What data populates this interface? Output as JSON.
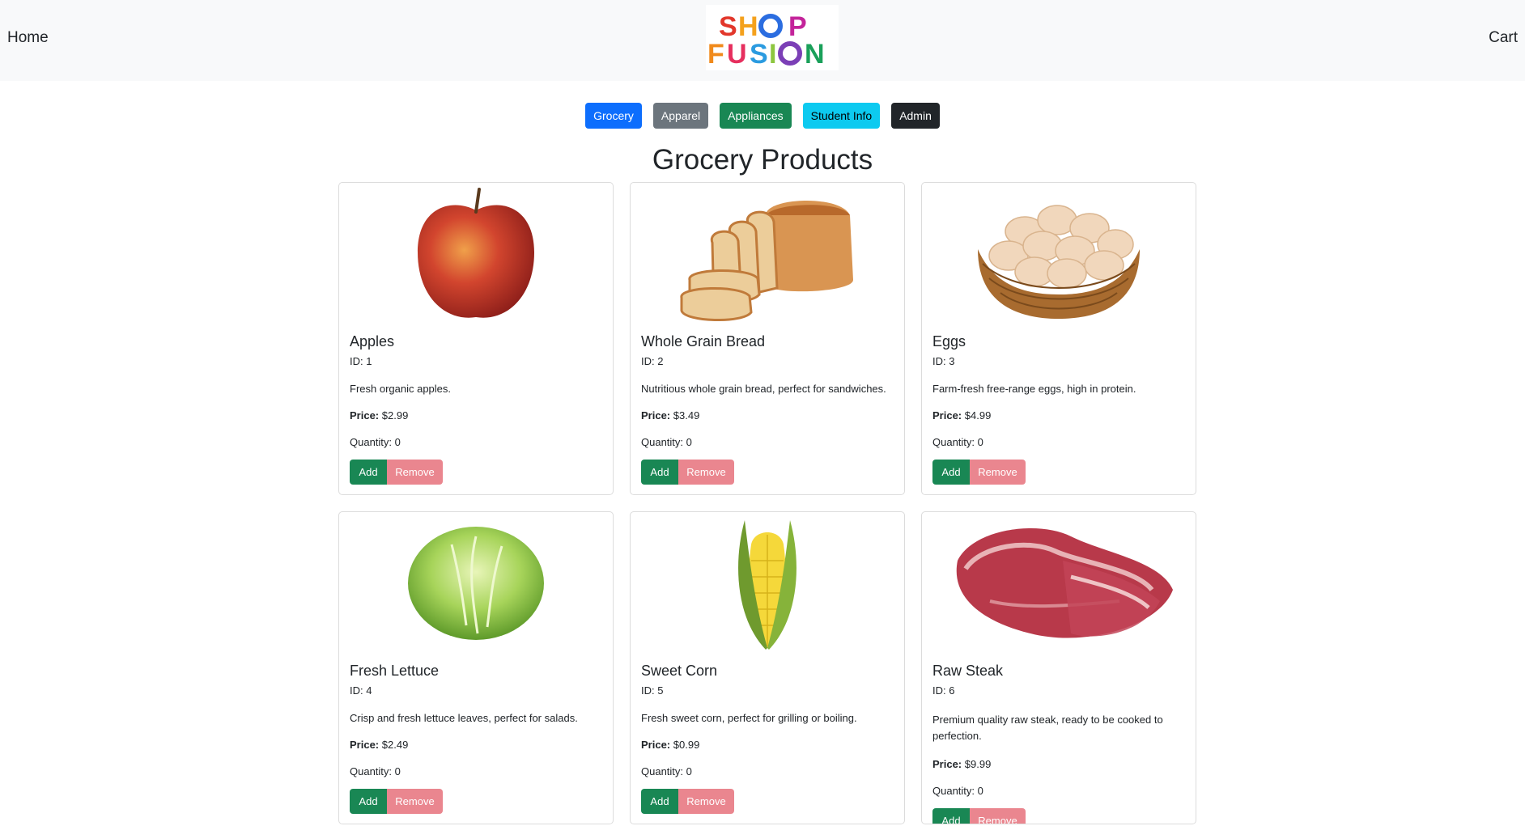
{
  "navbar": {
    "home_label": "Home",
    "cart_label": "Cart",
    "logo_text_line1": "SHOP",
    "logo_text_line2": "FUSION"
  },
  "categories": [
    {
      "label": "Grocery",
      "color": "#0d6efd"
    },
    {
      "label": "Apparel",
      "color": "#6c757d"
    },
    {
      "label": "Appliances",
      "color": "#198754"
    },
    {
      "label": "Student Info",
      "color": "#0dcaf0"
    },
    {
      "label": "Admin",
      "color": "#212529"
    }
  ],
  "page_title": "Grocery Products",
  "buttons": {
    "add_label": "Add",
    "remove_label": "Remove"
  },
  "labels": {
    "price_label": "Price:"
  },
  "products": [
    {
      "name": "Apples",
      "id_text": "ID: 1",
      "description": "Fresh organic apples.",
      "price": "$2.99",
      "quantity_text": "Quantity: 0",
      "image": "apple-image"
    },
    {
      "name": "Whole Grain Bread",
      "id_text": "ID: 2",
      "description": "Nutritious whole grain bread, perfect for sandwiches.",
      "price": "$3.49",
      "quantity_text": "Quantity: 0",
      "image": "bread-image"
    },
    {
      "name": "Eggs",
      "id_text": "ID: 3",
      "description": "Farm-fresh free-range eggs, high in protein.",
      "price": "$4.99",
      "quantity_text": "Quantity: 0",
      "image": "eggs-basket-image"
    },
    {
      "name": "Fresh Lettuce",
      "id_text": "ID: 4",
      "description": "Crisp and fresh lettuce leaves, perfect for salads.",
      "price": "$2.49",
      "quantity_text": "Quantity: 0",
      "image": "lettuce-image"
    },
    {
      "name": "Sweet Corn",
      "id_text": "ID: 5",
      "description": "Fresh sweet corn, perfect for grilling or boiling.",
      "price": "$0.99",
      "quantity_text": "Quantity: 0",
      "image": "corn-image"
    },
    {
      "name": "Raw Steak",
      "id_text": "ID: 6",
      "description": "Premium quality raw steak, ready to be cooked to perfection.",
      "price": "$9.99",
      "quantity_text": "Quantity: 0",
      "image": "steak-image"
    }
  ]
}
